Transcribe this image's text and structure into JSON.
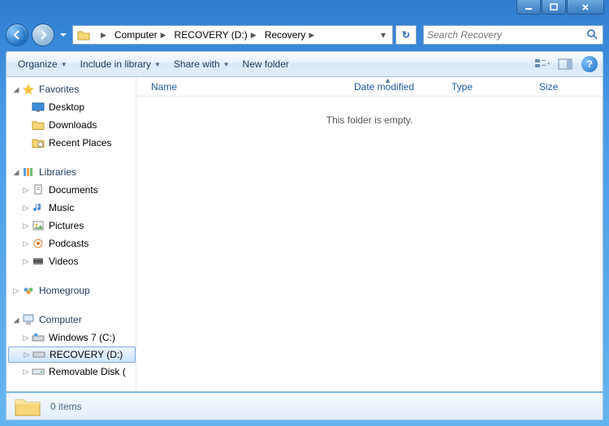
{
  "breadcrumbs": [
    "Computer",
    "RECOVERY (D:)",
    "Recovery"
  ],
  "search": {
    "placeholder": "Search Recovery"
  },
  "toolbar": {
    "organize": "Organize",
    "include": "Include in library",
    "share": "Share with",
    "newfolder": "New folder"
  },
  "columns": {
    "name": "Name",
    "date": "Date modified",
    "type": "Type",
    "size": "Size"
  },
  "empty_message": "This folder is empty.",
  "tree": {
    "favorites": {
      "label": "Favorites",
      "items": [
        "Desktop",
        "Downloads",
        "Recent Places"
      ]
    },
    "libraries": {
      "label": "Libraries",
      "items": [
        "Documents",
        "Music",
        "Pictures",
        "Podcasts",
        "Videos"
      ]
    },
    "homegroup": {
      "label": "Homegroup"
    },
    "computer": {
      "label": "Computer",
      "items": [
        "Windows 7 (C:)",
        "RECOVERY (D:)",
        "Removable Disk ("
      ]
    }
  },
  "status": {
    "count": "0 items"
  }
}
